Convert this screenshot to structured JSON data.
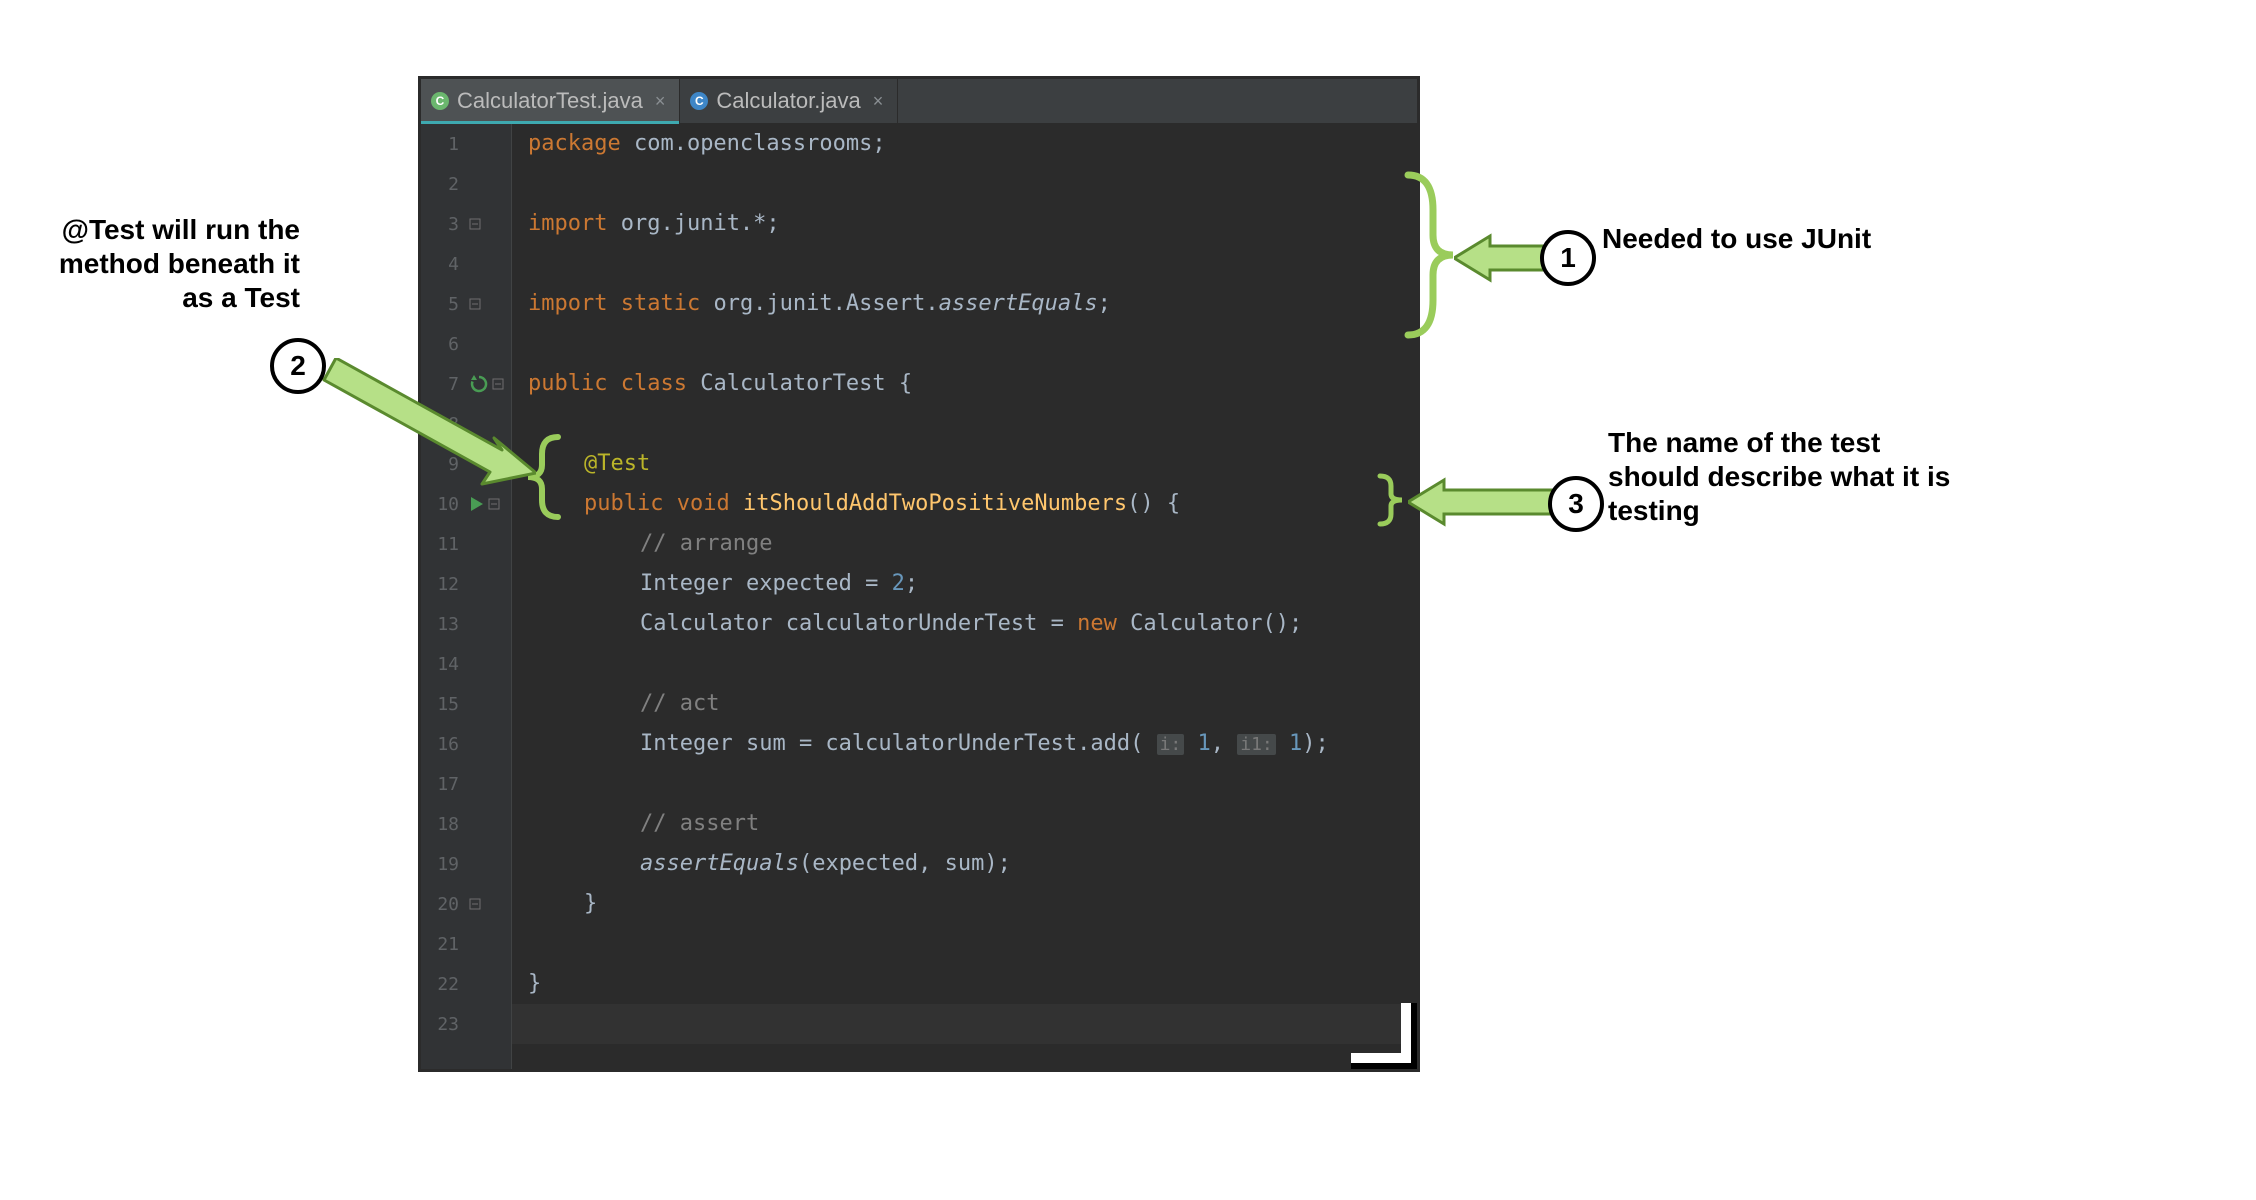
{
  "tabs": [
    {
      "label": "CalculatorTest.java",
      "icon": "C",
      "active": true
    },
    {
      "label": "Calculator.java",
      "icon": "C",
      "active": false
    }
  ],
  "gutter": {
    "line_count": 23,
    "run_icon_line": 10,
    "rerun_icon_line": 7
  },
  "code": {
    "l1": {
      "kw1": "package",
      "rest": " com.openclassrooms;"
    },
    "l3": {
      "kw1": "import",
      "rest": " org.junit.*;"
    },
    "l5": {
      "kw1": "import",
      "kw2": " static",
      "rest1": " org.junit.Assert.",
      "ital": "assertEquals",
      "rest2": ";"
    },
    "l7": {
      "kw1": "public",
      "kw2": " class",
      "cls": " CalculatorTest",
      "rest": " {"
    },
    "l9": {
      "ann": "@Test"
    },
    "l10": {
      "kw1": "public",
      "kw2": " void",
      "mth": " itShouldAddTwoPositiveNumbers",
      "paren": "()",
      "rest": " {"
    },
    "l11": {
      "cmt": "// arrange"
    },
    "l12": {
      "text1": "Integer expected = ",
      "num": "2",
      "text2": ";"
    },
    "l13": {
      "text1": "Calculator calculatorUnderTest = ",
      "kw": "new",
      "text2": " Calculator();"
    },
    "l15": {
      "cmt": "// act"
    },
    "l16": {
      "text1": "Integer sum = calculatorUnderTest.add( ",
      "hint1": "i:",
      "arg1": " 1",
      "sep": ", ",
      "hint2": "i1:",
      "arg2": " 1",
      "text2": ");"
    },
    "l18": {
      "cmt": "// assert"
    },
    "l19": {
      "ital": "assertEquals",
      "rest": "(expected, sum);"
    },
    "l20": {
      "text": "}"
    },
    "l22": {
      "text": "}"
    }
  },
  "annotations": {
    "a1": {
      "num": "1",
      "text": "Needed to use JUnit"
    },
    "a2": {
      "num": "2",
      "text": "@Test will run the method beneath it as a Test"
    },
    "a3": {
      "num": "3",
      "text": "The name of the test should describe what it is testing"
    }
  }
}
